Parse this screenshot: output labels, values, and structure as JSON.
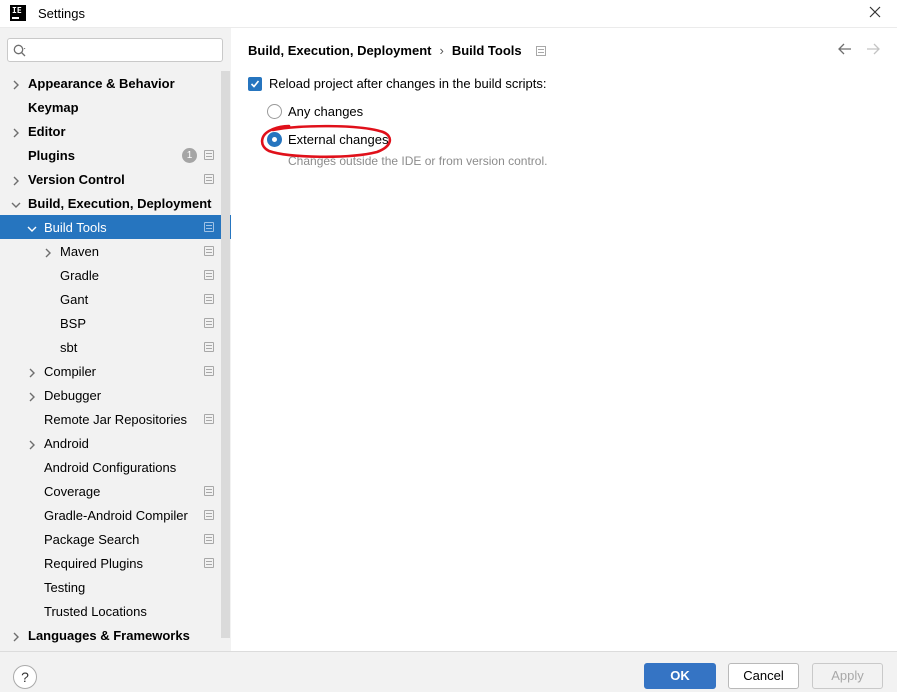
{
  "window": {
    "title": "Settings",
    "logo_text": "IE"
  },
  "search": {
    "placeholder": "",
    "value": ""
  },
  "sidebar": {
    "items": [
      {
        "label": "Appearance & Behavior",
        "bold": true,
        "expandable": true,
        "expanded": false,
        "level": 0
      },
      {
        "label": "Keymap",
        "bold": true,
        "expandable": false,
        "level": 0
      },
      {
        "label": "Editor",
        "bold": true,
        "expandable": true,
        "expanded": false,
        "level": 0
      },
      {
        "label": "Plugins",
        "bold": true,
        "expandable": false,
        "level": 0,
        "badge": "1",
        "project_icon": true
      },
      {
        "label": "Version Control",
        "bold": true,
        "expandable": true,
        "expanded": false,
        "level": 0,
        "project_icon": true
      },
      {
        "label": "Build, Execution, Deployment",
        "bold": true,
        "expandable": true,
        "expanded": true,
        "level": 0
      },
      {
        "label": "Build Tools",
        "bold": false,
        "expandable": true,
        "expanded": true,
        "level": 1,
        "selected": true,
        "project_icon": true
      },
      {
        "label": "Maven",
        "bold": false,
        "expandable": true,
        "expanded": false,
        "level": 2,
        "project_icon": true
      },
      {
        "label": "Gradle",
        "bold": false,
        "expandable": false,
        "level": 2,
        "project_icon": true
      },
      {
        "label": "Gant",
        "bold": false,
        "expandable": false,
        "level": 2,
        "project_icon": true
      },
      {
        "label": "BSP",
        "bold": false,
        "expandable": false,
        "level": 2,
        "project_icon": true
      },
      {
        "label": "sbt",
        "bold": false,
        "expandable": false,
        "level": 2,
        "project_icon": true
      },
      {
        "label": "Compiler",
        "bold": false,
        "expandable": true,
        "expanded": false,
        "level": 1,
        "project_icon": true
      },
      {
        "label": "Debugger",
        "bold": false,
        "expandable": true,
        "expanded": false,
        "level": 1
      },
      {
        "label": "Remote Jar Repositories",
        "bold": false,
        "expandable": false,
        "level": 1,
        "project_icon": true
      },
      {
        "label": "Android",
        "bold": false,
        "expandable": true,
        "expanded": false,
        "level": 1
      },
      {
        "label": "Android Configurations",
        "bold": false,
        "expandable": false,
        "level": 1
      },
      {
        "label": "Coverage",
        "bold": false,
        "expandable": false,
        "level": 1,
        "project_icon": true
      },
      {
        "label": "Gradle-Android Compiler",
        "bold": false,
        "expandable": false,
        "level": 1,
        "project_icon": true
      },
      {
        "label": "Package Search",
        "bold": false,
        "expandable": false,
        "level": 1,
        "project_icon": true
      },
      {
        "label": "Required Plugins",
        "bold": false,
        "expandable": false,
        "level": 1,
        "project_icon": true
      },
      {
        "label": "Testing",
        "bold": false,
        "expandable": false,
        "level": 1
      },
      {
        "label": "Trusted Locations",
        "bold": false,
        "expandable": false,
        "level": 1
      },
      {
        "label": "Languages & Frameworks",
        "bold": true,
        "expandable": true,
        "expanded": false,
        "level": 0
      }
    ]
  },
  "main": {
    "breadcrumb": {
      "parent": "Build, Execution, Deployment",
      "separator": "›",
      "current": "Build Tools"
    },
    "reload_checkbox": {
      "label": "Reload project after changes in the build scripts:",
      "checked": true
    },
    "radio_any": {
      "label": "Any changes",
      "checked": false
    },
    "radio_external": {
      "label": "External changes",
      "checked": true
    },
    "hint": "Changes outside the IDE or from version control."
  },
  "footer": {
    "help_label": "?",
    "ok_label": "OK",
    "cancel_label": "Cancel",
    "apply_label": "Apply"
  },
  "colors": {
    "accent": "#2675bf",
    "annotation": "#e0101a",
    "sidebar_bg": "#f2f2f2"
  }
}
